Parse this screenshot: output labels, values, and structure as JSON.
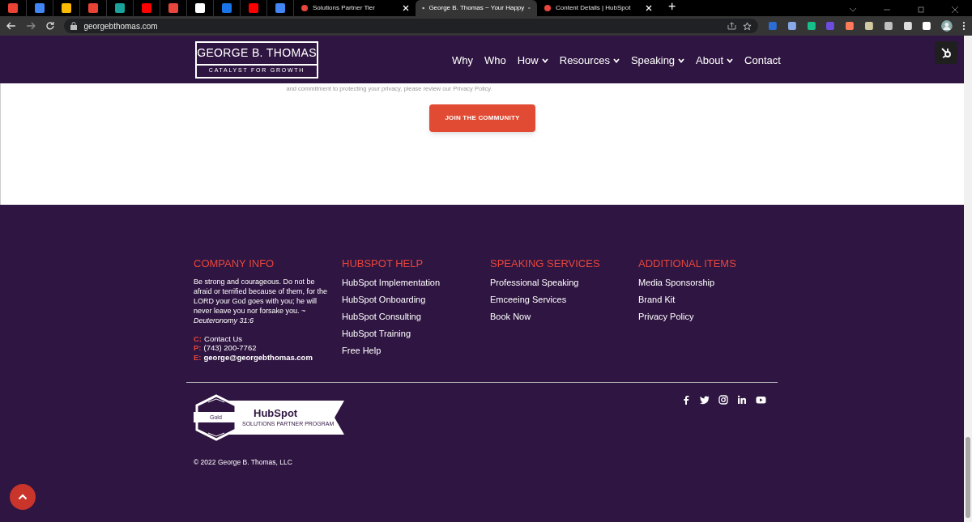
{
  "browser": {
    "tabs": [
      {
        "title": "Solutions Partner Tier",
        "selected": false
      },
      {
        "title": "George B. Thomas ~ Your Happy",
        "selected": true
      },
      {
        "title": "Content Details | HubSpot",
        "selected": false
      }
    ],
    "new_tab": "+",
    "address": "georgebthomas.com"
  },
  "header": {
    "logo_title": "GEORGE B. THOMAS",
    "logo_tagline": "CATALYST FOR GROWTH",
    "nav": [
      {
        "label": "Why",
        "dropdown": false
      },
      {
        "label": "Who",
        "dropdown": false
      },
      {
        "label": "How",
        "dropdown": true
      },
      {
        "label": "Resources",
        "dropdown": true
      },
      {
        "label": "Speaking",
        "dropdown": true
      },
      {
        "label": "About",
        "dropdown": true
      },
      {
        "label": "Contact",
        "dropdown": false
      }
    ]
  },
  "privacy_note": "and commitment to protecting your privacy, please review our Privacy Policy.",
  "cta": "JOIN THE COMMUNITY",
  "footer": {
    "columns": [
      {
        "heading": "COMPANY INFO",
        "quote": "Be strong and courageous. Do not be afraid or terrified because of them, for the LORD your God goes with you; he will never leave you nor forsake you. ~ *Deuteronomy 31:6*",
        "contacts": [
          {
            "label": "C:",
            "value": "Contact Us",
            "bold": false
          },
          {
            "label": "P:",
            "value": "(743) 200-7762",
            "bold": false
          },
          {
            "label": "E:",
            "value": "george@georgebthomas.com",
            "bold": true
          }
        ]
      },
      {
        "heading": "HUBSPOT HELP",
        "links": [
          "HubSpot Implementation",
          "HubSpot Onboarding",
          "HubSpot Consulting",
          "HubSpot Training",
          "Free Help"
        ]
      },
      {
        "heading": "SPEAKING SERVICES",
        "links": [
          "Professional Speaking",
          "Emceeing Services",
          "Book Now"
        ]
      },
      {
        "heading": "ADDITIONAL ITEMS",
        "links": [
          "Media Sponsorship",
          "Brand Kit",
          "Privacy Policy"
        ]
      }
    ],
    "badge": {
      "tier": "Gold",
      "brand": "HubSpot",
      "program": "SOLUTIONS PARTNER PROGRAM"
    },
    "copyright": "© 2022 George B. Thomas, LLC"
  }
}
